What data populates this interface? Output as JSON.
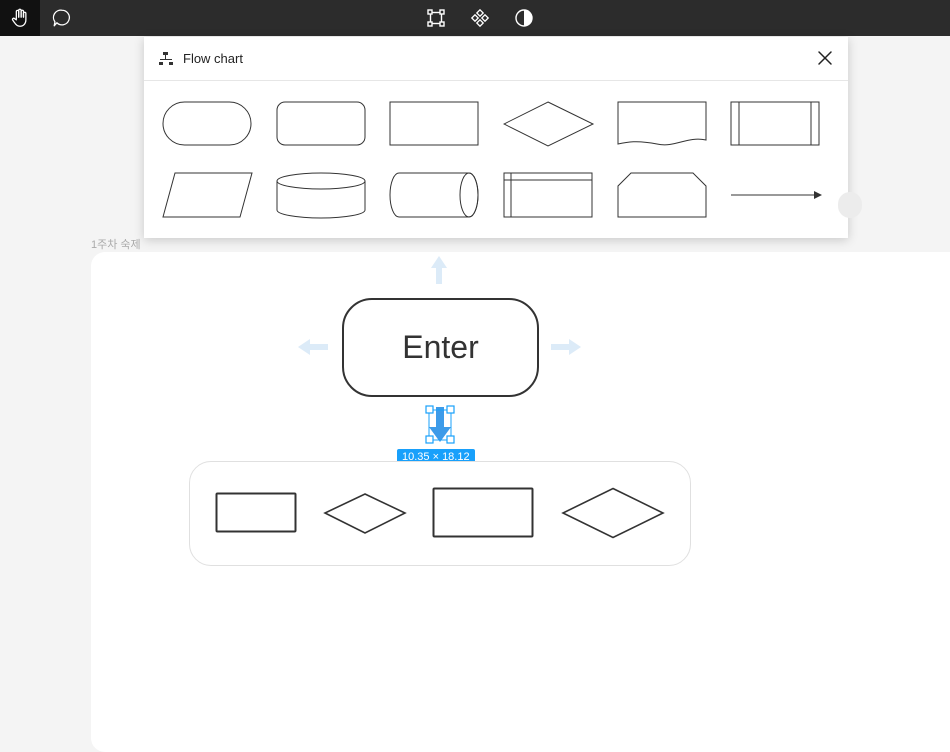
{
  "toolbar": {
    "tools": [
      {
        "name": "hand-icon",
        "active": true
      },
      {
        "name": "comment-icon",
        "active": false
      },
      {
        "name": "frame-select-icon",
        "active": false
      },
      {
        "name": "component-icon",
        "active": false
      },
      {
        "name": "contrast-icon",
        "active": false
      }
    ]
  },
  "frame": {
    "label": "1주차 숙제"
  },
  "panel": {
    "title": "Flow chart",
    "shapes": [
      "terminator-shape-icon",
      "rounded-rect-shape-icon",
      "process-shape-icon",
      "decision-shape-icon",
      "document-shape-icon",
      "predefined-process-shape-icon",
      "data-shape-icon",
      "database-shape-icon",
      "direct-access-storage-shape-icon",
      "internal-storage-shape-icon",
      "manual-operation-shape-icon",
      "connector-arrow-icon"
    ]
  },
  "canvas": {
    "node_text": "Enter",
    "dimension": "10.35 × 18.12",
    "accent": "#18a0fb"
  },
  "picker": {
    "options": [
      "small-rectangle-option",
      "small-diamond-option",
      "large-rectangle-option",
      "large-diamond-option"
    ]
  }
}
